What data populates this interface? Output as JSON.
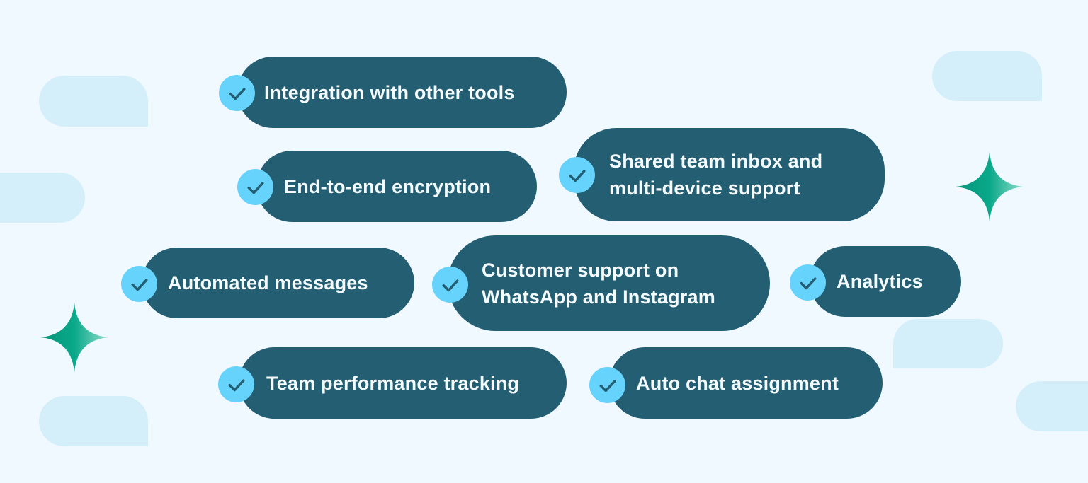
{
  "colors": {
    "background": "#eff9ff",
    "bubble": "#d5effa",
    "pill": "#245e72",
    "pill_text": "#f4fbff",
    "check_circle": "#66d3fc",
    "check_mark": "#245e72",
    "sparkle_dark": "#06967a",
    "sparkle_light": "#7fd9c6"
  },
  "features": [
    {
      "id": "integration",
      "label": "Integration with other tools",
      "icon": "check-icon"
    },
    {
      "id": "encryption",
      "label": "End-to-end encryption",
      "icon": "check-icon"
    },
    {
      "id": "shared-inbox",
      "lines": [
        "Shared team inbox and",
        "multi-device support"
      ],
      "icon": "check-icon"
    },
    {
      "id": "automated-messages",
      "label": "Automated messages",
      "icon": "check-icon"
    },
    {
      "id": "customer-support",
      "lines": [
        "Customer support on",
        "WhatsApp and Instagram"
      ],
      "icon": "check-icon"
    },
    {
      "id": "analytics",
      "label": "Analytics",
      "icon": "check-icon"
    },
    {
      "id": "team-performance",
      "label": "Team performance tracking",
      "icon": "check-icon"
    },
    {
      "id": "auto-chat",
      "label": "Auto chat assignment",
      "icon": "check-icon"
    }
  ],
  "decorations": {
    "bubbles": [
      "chat-bubble-icon",
      "chat-bubble-icon",
      "chat-bubble-icon",
      "chat-bubble-icon",
      "chat-bubble-icon",
      "chat-bubble-icon"
    ],
    "sparkles": [
      "sparkle-icon",
      "sparkle-icon"
    ]
  }
}
